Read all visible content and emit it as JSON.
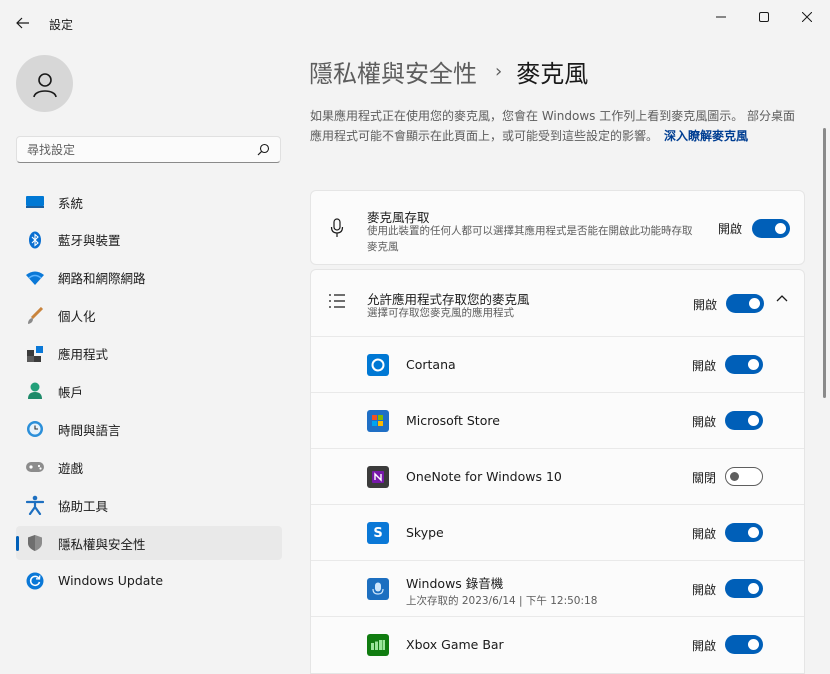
{
  "window": {
    "title": "設定",
    "controls": [
      "minimize-icon",
      "maximize-icon",
      "close-icon"
    ]
  },
  "sidebar": {
    "search_placeholder": "尋找設定",
    "items": [
      {
        "label": "系統",
        "icon": "system-icon",
        "selected": false
      },
      {
        "label": "藍牙與裝置",
        "icon": "bluetooth-icon",
        "selected": false
      },
      {
        "label": "網路和網際網路",
        "icon": "wifi-icon",
        "selected": false
      },
      {
        "label": "個人化",
        "icon": "brush-icon",
        "selected": false
      },
      {
        "label": "應用程式",
        "icon": "apps-icon",
        "selected": false
      },
      {
        "label": "帳戶",
        "icon": "account-icon",
        "selected": false
      },
      {
        "label": "時間與語言",
        "icon": "time-language-icon",
        "selected": false
      },
      {
        "label": "遊戲",
        "icon": "gamepad-icon",
        "selected": false
      },
      {
        "label": "協助工具",
        "icon": "accessibility-icon",
        "selected": false
      },
      {
        "label": "隱私權與安全性",
        "icon": "shield-icon",
        "selected": true
      },
      {
        "label": "Windows Update",
        "icon": "windows-update-icon",
        "selected": false
      }
    ]
  },
  "main": {
    "breadcrumb": {
      "parent": "隱私權與安全性",
      "separator": "›",
      "current": "麥克風"
    },
    "description": "如果應用程式正在使用您的麥克風，您會在 Windows 工作列上看到麥克風圖示。 部分桌面應用程式可能不會顯示在此頁面上，或可能受到這些設定的影響。",
    "learn_more": "深入瞭解麥克風",
    "mic_access": {
      "title": "麥克風存取",
      "description": "使用此裝置的任何人都可以選擇其應用程式是否能在開啟此功能時存取麥克風",
      "state_label": "開啟",
      "on": true
    },
    "app_access": {
      "title": "允許應用程式存取您的麥克風",
      "description": "選擇可存取您麥克風的應用程式",
      "state_label": "開啟",
      "on": true,
      "expanded": true
    },
    "apps": [
      {
        "name": "Cortana",
        "sub": "",
        "state_label": "開啟",
        "on": true,
        "icon": "cortana-icon",
        "color": "#0078d4"
      },
      {
        "name": "Microsoft Store",
        "sub": "",
        "state_label": "開啟",
        "on": true,
        "icon": "store-icon",
        "color": "#1f6fc5"
      },
      {
        "name": "OneNote for Windows 10",
        "sub": "",
        "state_label": "關閉",
        "on": false,
        "icon": "onenote-icon",
        "color": "#7719aa"
      },
      {
        "name": "Skype",
        "sub": "",
        "state_label": "開啟",
        "on": true,
        "icon": "skype-icon",
        "color": "#0a78d7"
      },
      {
        "name": "Windows 錄音機",
        "sub": "上次存取的 2023/6/14 | 下午 12:50:18",
        "state_label": "開啟",
        "on": true,
        "icon": "voice-recorder-icon",
        "color": "#1d6fc0"
      },
      {
        "name": "Xbox Game Bar",
        "sub": "",
        "state_label": "開啟",
        "on": true,
        "icon": "xbox-game-bar-icon",
        "color": "#107c10"
      }
    ]
  },
  "colors": {
    "accent": "#005fb8",
    "background": "#f3f3f3",
    "card": "#fbfbfb"
  }
}
